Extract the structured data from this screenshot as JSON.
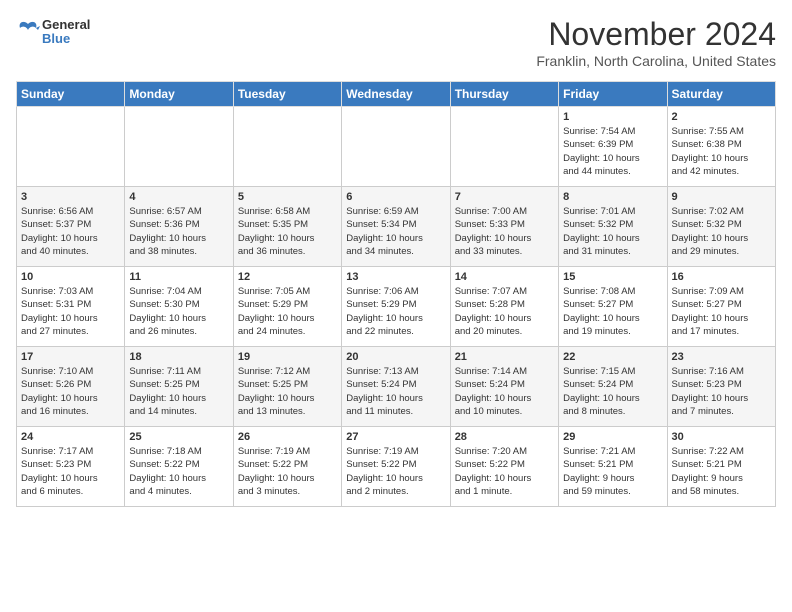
{
  "logo": {
    "line1": "General",
    "line2": "Blue"
  },
  "title": "November 2024",
  "subtitle": "Franklin, North Carolina, United States",
  "days_of_week": [
    "Sunday",
    "Monday",
    "Tuesday",
    "Wednesday",
    "Thursday",
    "Friday",
    "Saturday"
  ],
  "weeks": [
    [
      {
        "day": "",
        "info": ""
      },
      {
        "day": "",
        "info": ""
      },
      {
        "day": "",
        "info": ""
      },
      {
        "day": "",
        "info": ""
      },
      {
        "day": "",
        "info": ""
      },
      {
        "day": "1",
        "info": "Sunrise: 7:54 AM\nSunset: 6:39 PM\nDaylight: 10 hours\nand 44 minutes."
      },
      {
        "day": "2",
        "info": "Sunrise: 7:55 AM\nSunset: 6:38 PM\nDaylight: 10 hours\nand 42 minutes."
      }
    ],
    [
      {
        "day": "3",
        "info": "Sunrise: 6:56 AM\nSunset: 5:37 PM\nDaylight: 10 hours\nand 40 minutes."
      },
      {
        "day": "4",
        "info": "Sunrise: 6:57 AM\nSunset: 5:36 PM\nDaylight: 10 hours\nand 38 minutes."
      },
      {
        "day": "5",
        "info": "Sunrise: 6:58 AM\nSunset: 5:35 PM\nDaylight: 10 hours\nand 36 minutes."
      },
      {
        "day": "6",
        "info": "Sunrise: 6:59 AM\nSunset: 5:34 PM\nDaylight: 10 hours\nand 34 minutes."
      },
      {
        "day": "7",
        "info": "Sunrise: 7:00 AM\nSunset: 5:33 PM\nDaylight: 10 hours\nand 33 minutes."
      },
      {
        "day": "8",
        "info": "Sunrise: 7:01 AM\nSunset: 5:32 PM\nDaylight: 10 hours\nand 31 minutes."
      },
      {
        "day": "9",
        "info": "Sunrise: 7:02 AM\nSunset: 5:32 PM\nDaylight: 10 hours\nand 29 minutes."
      }
    ],
    [
      {
        "day": "10",
        "info": "Sunrise: 7:03 AM\nSunset: 5:31 PM\nDaylight: 10 hours\nand 27 minutes."
      },
      {
        "day": "11",
        "info": "Sunrise: 7:04 AM\nSunset: 5:30 PM\nDaylight: 10 hours\nand 26 minutes."
      },
      {
        "day": "12",
        "info": "Sunrise: 7:05 AM\nSunset: 5:29 PM\nDaylight: 10 hours\nand 24 minutes."
      },
      {
        "day": "13",
        "info": "Sunrise: 7:06 AM\nSunset: 5:29 PM\nDaylight: 10 hours\nand 22 minutes."
      },
      {
        "day": "14",
        "info": "Sunrise: 7:07 AM\nSunset: 5:28 PM\nDaylight: 10 hours\nand 20 minutes."
      },
      {
        "day": "15",
        "info": "Sunrise: 7:08 AM\nSunset: 5:27 PM\nDaylight: 10 hours\nand 19 minutes."
      },
      {
        "day": "16",
        "info": "Sunrise: 7:09 AM\nSunset: 5:27 PM\nDaylight: 10 hours\nand 17 minutes."
      }
    ],
    [
      {
        "day": "17",
        "info": "Sunrise: 7:10 AM\nSunset: 5:26 PM\nDaylight: 10 hours\nand 16 minutes."
      },
      {
        "day": "18",
        "info": "Sunrise: 7:11 AM\nSunset: 5:25 PM\nDaylight: 10 hours\nand 14 minutes."
      },
      {
        "day": "19",
        "info": "Sunrise: 7:12 AM\nSunset: 5:25 PM\nDaylight: 10 hours\nand 13 minutes."
      },
      {
        "day": "20",
        "info": "Sunrise: 7:13 AM\nSunset: 5:24 PM\nDaylight: 10 hours\nand 11 minutes."
      },
      {
        "day": "21",
        "info": "Sunrise: 7:14 AM\nSunset: 5:24 PM\nDaylight: 10 hours\nand 10 minutes."
      },
      {
        "day": "22",
        "info": "Sunrise: 7:15 AM\nSunset: 5:24 PM\nDaylight: 10 hours\nand 8 minutes."
      },
      {
        "day": "23",
        "info": "Sunrise: 7:16 AM\nSunset: 5:23 PM\nDaylight: 10 hours\nand 7 minutes."
      }
    ],
    [
      {
        "day": "24",
        "info": "Sunrise: 7:17 AM\nSunset: 5:23 PM\nDaylight: 10 hours\nand 6 minutes."
      },
      {
        "day": "25",
        "info": "Sunrise: 7:18 AM\nSunset: 5:22 PM\nDaylight: 10 hours\nand 4 minutes."
      },
      {
        "day": "26",
        "info": "Sunrise: 7:19 AM\nSunset: 5:22 PM\nDaylight: 10 hours\nand 3 minutes."
      },
      {
        "day": "27",
        "info": "Sunrise: 7:19 AM\nSunset: 5:22 PM\nDaylight: 10 hours\nand 2 minutes."
      },
      {
        "day": "28",
        "info": "Sunrise: 7:20 AM\nSunset: 5:22 PM\nDaylight: 10 hours\nand 1 minute."
      },
      {
        "day": "29",
        "info": "Sunrise: 7:21 AM\nSunset: 5:21 PM\nDaylight: 9 hours\nand 59 minutes."
      },
      {
        "day": "30",
        "info": "Sunrise: 7:22 AM\nSunset: 5:21 PM\nDaylight: 9 hours\nand 58 minutes."
      }
    ]
  ]
}
